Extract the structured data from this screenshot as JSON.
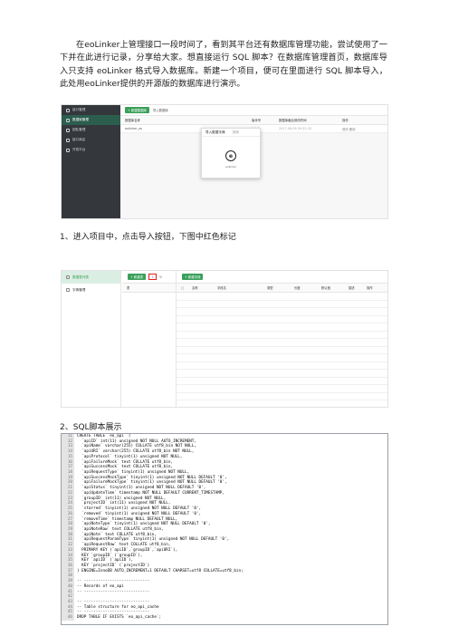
{
  "intro": "在eoLinker上管理接口一段时间了，看到其平台还有数据库管理功能，尝试使用了一下并在此进行记录，分享给大家。想直接运行 SQL 脚本？在数据库管理首页，数据库导入只支持 eoLinker 格式导入数据库。新建一个项目，便可在里面进行 SQL 脚本导入，此处用eoLinker提供的开源版的数据库进行演示。",
  "step1": "1、进入项目中，点击导入按钮，下图中红色标记",
  "step2": "2、SQL脚本展示",
  "shot1": {
    "sidebar": [
      "接口管理",
      "数据库管理",
      "团队管理",
      "接口商店",
      "开放平台"
    ],
    "toolbar": [
      "+ 新建数据库",
      "导入数据库"
    ],
    "headers": [
      "数据库名称",
      "版本号",
      "数据库最后修改时间",
      "操作"
    ],
    "row": [
      "eolinker_os",
      "1.1.0",
      "2017-08-09 09:52:33",
      "修改 删除"
    ],
    "modal_title": "导入数据字典",
    "modal_close": "关闭",
    "modal_caption": "eolinker"
  },
  "shot2": {
    "sidebar": [
      "数据表列表",
      "字典管理"
    ],
    "left_btn": "+ 新建表",
    "mid_btn": "+ 新建字段",
    "left_header": "表",
    "headers": [
      "名称",
      "字段名",
      "类型",
      "长度",
      "默认值",
      "描述",
      "操作"
    ]
  },
  "code_lines": [
    {
      "n": "11",
      "t": "CREATE TABLE `eo_api` ("
    },
    {
      "n": "12",
      "t": "  `apiID` int(11) unsigned NOT NULL AUTO_INCREMENT,"
    },
    {
      "n": "13",
      "t": "  `apiName` varchar(255) COLLATE utf8_bin NOT NULL,"
    },
    {
      "n": "14",
      "t": "  `apiURI` varchar(255) COLLATE utf8_bin NOT NULL,"
    },
    {
      "n": "15",
      "t": "  `apiProtocol` tinyint(1) unsigned NOT NULL,"
    },
    {
      "n": "16",
      "t": "  `apiFailureMock` text COLLATE utf8_bin,"
    },
    {
      "n": "17",
      "t": "  `apiSuccessMock` text COLLATE utf8_bin,"
    },
    {
      "n": "18",
      "t": "  `apiRequestType` tinyint(1) unsigned NOT NULL,"
    },
    {
      "n": "19",
      "t": "  `apiSuccessMockType` tinyint(1) unsigned NOT NULL DEFAULT '0',"
    },
    {
      "n": "20",
      "t": "  `apiFailureMockType` tinyint(1) unsigned NOT NULL DEFAULT '0',"
    },
    {
      "n": "21",
      "t": "  `apiStatus` tinyint(1) unsigned NOT NULL DEFAULT '0',"
    },
    {
      "n": "22",
      "t": "  `apiUpdateTime` timestamp NOT NULL DEFAULT CURRENT_TIMESTAMP,"
    },
    {
      "n": "23",
      "t": "  `groupID` int(11) unsigned NOT NULL,"
    },
    {
      "n": "24",
      "t": "  `projectID` int(11) unsigned NOT NULL,"
    },
    {
      "n": "25",
      "t": "  `starred` tinyint(1) unsigned NOT NULL DEFAULT '0',"
    },
    {
      "n": "26",
      "t": "  `removed` tinyint(1) unsigned NOT NULL DEFAULT '0',"
    },
    {
      "n": "27",
      "t": "  `removeTime` timestamp NULL DEFAULT NULL,"
    },
    {
      "n": "28",
      "t": "  `apiNoteType` tinyint(1) unsigned NOT NULL DEFAULT '0',"
    },
    {
      "n": "29",
      "t": "  `apiNoteRaw` text COLLATE utf8_bin,"
    },
    {
      "n": "30",
      "t": "  `apiNote` text COLLATE utf8_bin,"
    },
    {
      "n": "31",
      "t": "  `apiRequestParamType` tinyint(1) unsigned NOT NULL DEFAULT '0',"
    },
    {
      "n": "32",
      "t": "  `apiRequestRaw` text COLLATE utf8_bin,"
    },
    {
      "n": "33",
      "t": "  PRIMARY KEY (`apiID`,`groupID`,`apiURI`),"
    },
    {
      "n": "34",
      "t": "  KEY `groupID` (`groupID`),"
    },
    {
      "n": "35",
      "t": "  KEY `apiID` (`apiID`),"
    },
    {
      "n": "36",
      "t": "  KEY `projectID` (`projectID`)"
    },
    {
      "n": "37",
      "t": ") ENGINE=InnoDB AUTO_INCREMENT=1 DEFAULT CHARSET=utf8 COLLATE=utf8_bin;"
    },
    {
      "n": "38",
      "t": ""
    },
    {
      "n": "39",
      "t": "-- ----------------------------"
    },
    {
      "n": "40",
      "t": "-- Records of eo_api"
    },
    {
      "n": "41",
      "t": "-- ----------------------------"
    },
    {
      "n": "42",
      "t": ""
    },
    {
      "n": "43",
      "t": "-- ----------------------------"
    },
    {
      "n": "44",
      "t": "-- Table structure for eo_api_cache"
    },
    {
      "n": "45",
      "t": "-- ----------------------------"
    },
    {
      "n": "46",
      "t": "DROP TABLE IF EXISTS `eo_api_cache`;"
    }
  ]
}
